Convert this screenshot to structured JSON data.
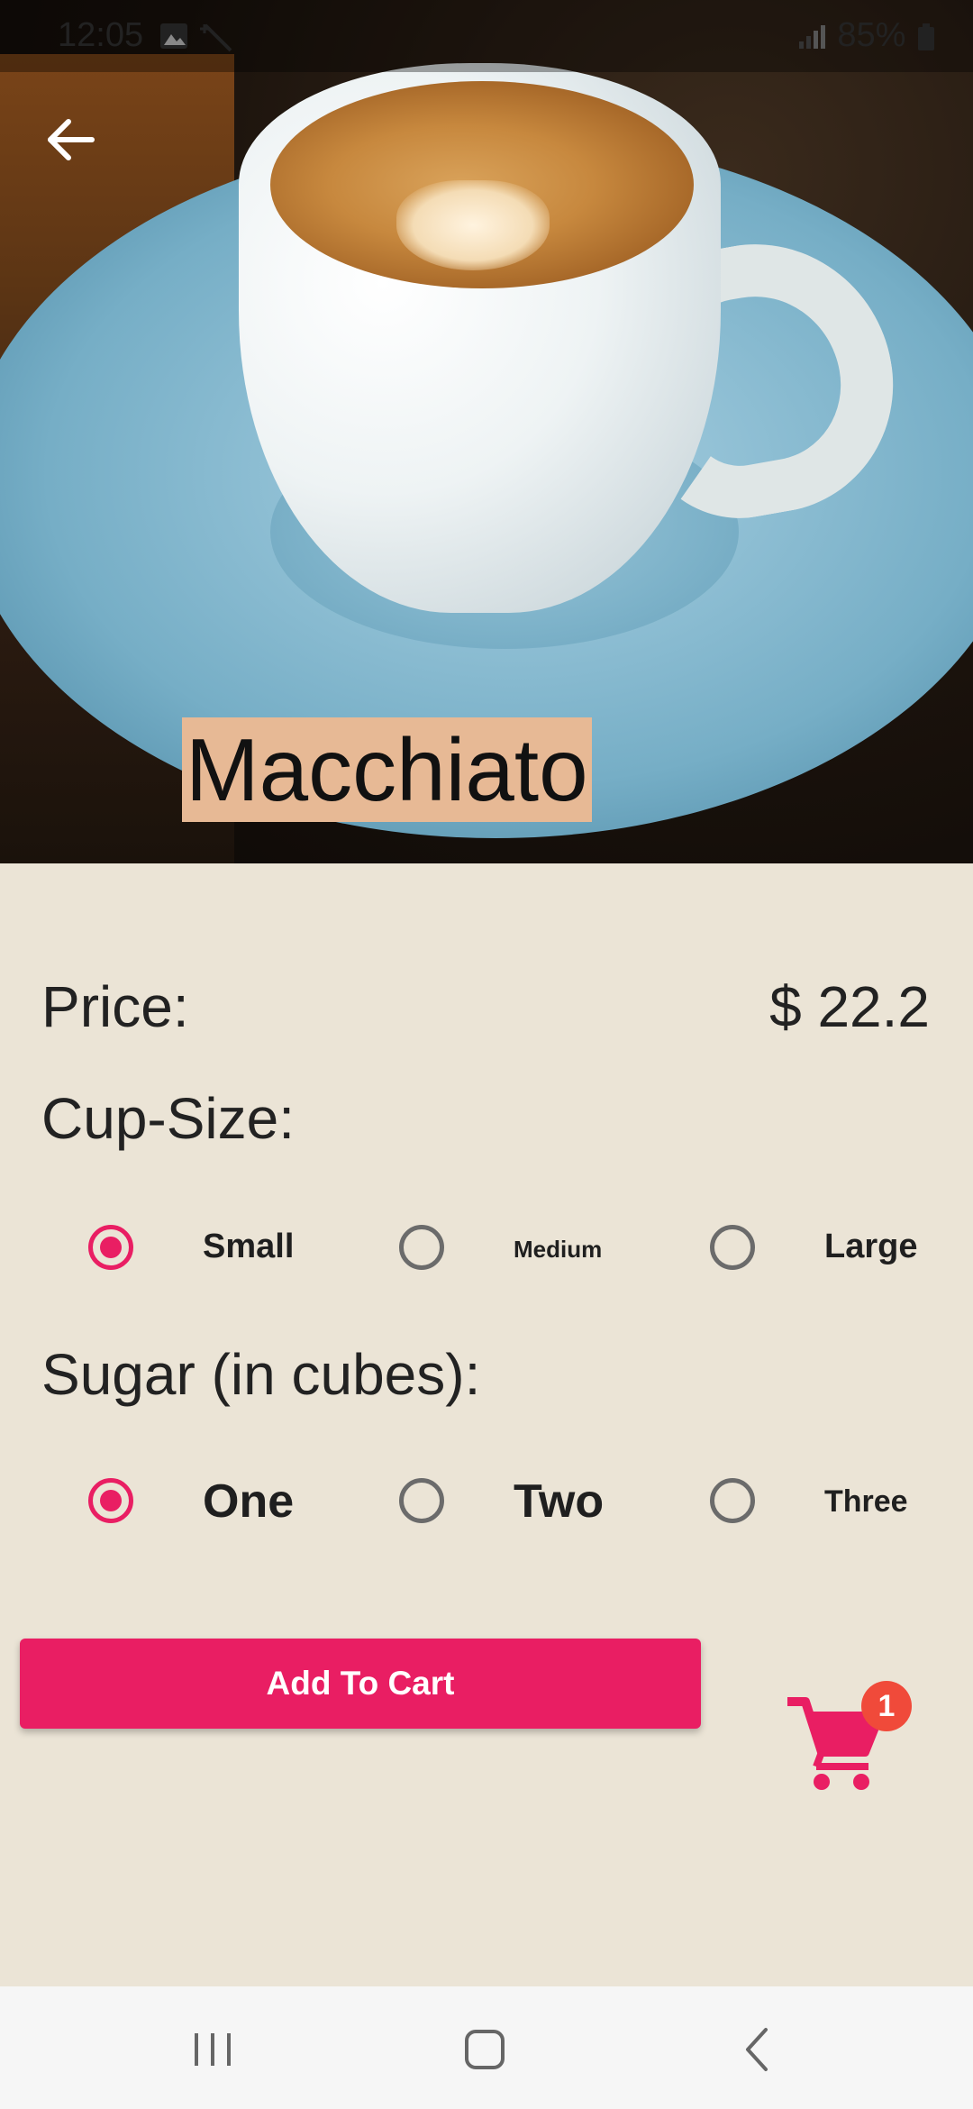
{
  "status_bar": {
    "time": "12:05",
    "battery": "85%"
  },
  "product": {
    "name": "Macchiato"
  },
  "price": {
    "label": "Price:",
    "value": "$ 22.2"
  },
  "cup_size": {
    "label": "Cup-Size:",
    "options": [
      "Small",
      "Medium",
      "Large"
    ],
    "selected": "Small"
  },
  "sugar": {
    "label": "Sugar (in cubes):",
    "options": [
      "One",
      "Two",
      "Three"
    ],
    "selected": "One"
  },
  "actions": {
    "add_to_cart": "Add To Cart"
  },
  "cart": {
    "count": "1"
  },
  "colors": {
    "accent": "#e91e63",
    "badge": "#f04a3a",
    "background": "#ebe4d6",
    "title_highlight": "#e7b995"
  },
  "icons": [
    "back-arrow-icon",
    "cart-icon",
    "recents-icon",
    "home-icon",
    "nav-back-icon"
  ]
}
